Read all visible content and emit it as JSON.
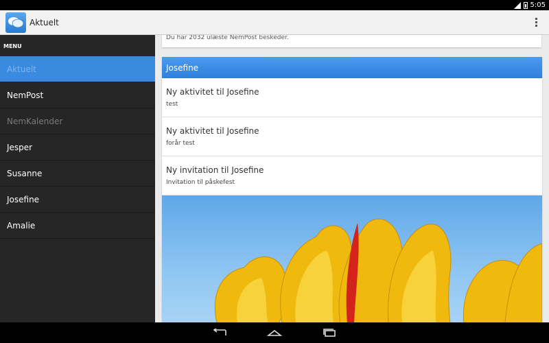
{
  "status_bar": {
    "time": "5:05"
  },
  "action_bar": {
    "title": "Aktuelt"
  },
  "sidebar": {
    "header": "MENU",
    "items": [
      {
        "label": "Aktuelt"
      },
      {
        "label": "NemPost"
      },
      {
        "label": "NemKalender"
      },
      {
        "label": "Jesper"
      },
      {
        "label": "Susanne"
      },
      {
        "label": "Josefine"
      },
      {
        "label": "Amalie"
      }
    ]
  },
  "main": {
    "top_notice": "Du har 2032 ulæste NemPost beskeder.",
    "card": {
      "title": "Josefine",
      "activities": [
        {
          "title": "Ny aktivitet til Josefine",
          "subtitle": "test"
        },
        {
          "title": "Ny aktivitet til Josefine",
          "subtitle": "forår test"
        },
        {
          "title": "Ny invitation til Josefine",
          "subtitle": "Invitation til påskefest"
        }
      ]
    }
  },
  "colors": {
    "accent": "#3a8be0",
    "sidebar_bg": "#262626",
    "tulip": "#f5c518"
  }
}
